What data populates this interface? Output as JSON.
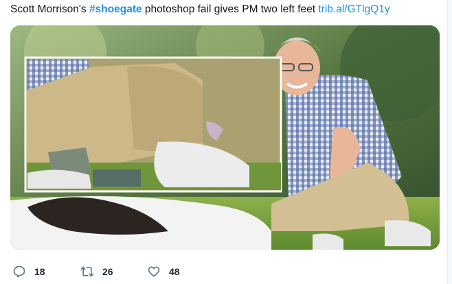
{
  "tweet": {
    "text_before": "Scott Morrison's ",
    "hashtag": "#shoegate",
    "text_after": " photoshop fail gives PM two left feet ",
    "link": "trib.al/GTlgQ1y"
  },
  "actions": {
    "reply_count": "18",
    "retweet_count": "26",
    "like_count": "48"
  },
  "colors": {
    "link": "#1b95e0",
    "action_icon": "#657786",
    "text": "#14171a"
  },
  "icons": {
    "reply": "reply-icon",
    "retweet": "retweet-icon",
    "like": "heart-icon"
  }
}
